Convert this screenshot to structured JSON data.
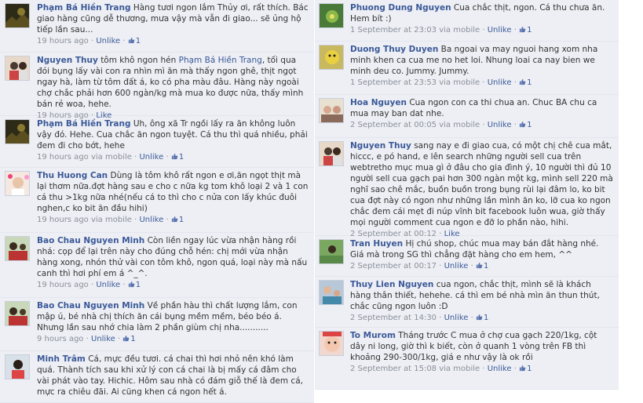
{
  "left_comments": [
    {
      "author": "Phạm Bá Hiền Trang",
      "text": "Hàng tươi ngon lắm Thủy ơi, rất thích. Bác giao hàng cũng dễ thương, mưa vậy mà vẫn đi giao... sẽ ủng hộ tiếp lần sau...",
      "time": "19 hours ago",
      "via": "",
      "action": "Unlike",
      "likes": "1",
      "avatar": "dark-landscape"
    },
    {
      "author": "Nguyen Thuy",
      "mention": "Phạm Bá Hiền Trang",
      "text": "tôm khô ngon hén Phạm Bá Hiền Trang, tối qua đói bụng lấy vài con ra nhìn mì ăn mà thấy ngon ghê, thịt ngọt ngay hà, làm từ tôm đất á, ko có pha màu đâu. Hàng này ngoài chợ chắc phải hơn 600 ngàn/kg mà mua ko được nữa, thấy mình bán rẻ woa, hehe.",
      "time": "19 hours ago",
      "via": "",
      "action": "Like",
      "likes": "",
      "avatar": "couple"
    },
    {
      "author": "Phạm Bá Hiền Trang",
      "text": "Uh, ông xã Tr ngồi lấy ra ăn không luôn vậy đó. Hehe. Cua chắc ăn ngon tuyệt. Cá thu thì quá nhiều, phải đem đi cho bớt, hehe",
      "time": "19 hours ago",
      "via": "via mobile",
      "action": "Unlike",
      "likes": "1",
      "avatar": "dark-landscape"
    },
    {
      "author": "Thu Huong Can",
      "text": "Dùng là tôm khô rất ngon e ơi,ăn ngọt thịt mà lại thơm nữa.đợt hàng sau e cho c nữa kg tom khô loại 2 và 1 con cá thu >1kg nữa nhé(nếu cá to thì cho c nửa con lấy khúc đuôi nghen,c ko bit ăn đầu hihi)",
      "time": "19 hours ago",
      "via": "via mobile",
      "action": "Unlike",
      "likes": "1",
      "avatar": "baby-flowers"
    },
    {
      "author": "Bao Chau Nguyen Minh",
      "text": "Còn liền ngay lúc vừa nhận hàng rồi nhá: cọp để lại trên này cho đúng chỗ hén: chị mới vừa nhận hàng xong, nhón thử vài con tôm khô, ngon quá, loại này mà nấu canh thì hơi phí em á ^_^.",
      "time": "19 hours ago",
      "via": "",
      "action": "Unlike",
      "likes": "1",
      "avatar": "family"
    },
    {
      "author": "Bao Chau Nguyen Minh",
      "text": "Về phần hàu thì chất lượng lắm, con mập ú, bé nhà chị thích ăn cái bụng mềm mềm, béo béo á. Nhưng lần sau nhớ chia làm 2 phần giùm chị nha...........",
      "time": "9 hours ago",
      "via": "",
      "action": "Unlike",
      "likes": "1",
      "avatar": "family"
    },
    {
      "author": "Minh Trâm",
      "text": "Cá, mực đều tươi. cá chai thì hơi nhỏ nên khó làm quá. Thành tích sau khi xử lý con cá chai là bị mấy cá đâm cho vài phát vào tay. Hichic. Hôm sau nhà có đám giỗ thế là đem cá, mực ra chiêu đãi. Ai cũng khen cá ngon hết á.",
      "time": "",
      "via": "",
      "action": "",
      "likes": "",
      "avatar": "woman"
    }
  ],
  "right_comments": [
    {
      "author": "Phuong Dung Nguyen",
      "text": "Cua chắc thịt, ngon. Cá thu chưa ăn. Hem bít :)",
      "time": "1 September at 23:03",
      "via": "via mobile",
      "action": "Unlike",
      "likes": "1",
      "avatar": "flower-green"
    },
    {
      "author": "Duong Thuy Duyen",
      "text": "Ba ngoai va may nguoi hang xom nha minh khen ca cua me no het loi. Nhung loai ca nay bien we minh deu co. Jummy. Jummy.",
      "time": "1 September at 23:53",
      "via": "via mobile",
      "action": "Unlike",
      "likes": "1",
      "avatar": "toy-yellow"
    },
    {
      "author": "Hoa Nguyen",
      "text": "Cua ngon con ca thi chua an. Chuc BA chu ca mua may ban dat nhe.",
      "time": "2 September at 00:05",
      "via": "via mobile",
      "action": "Unlike",
      "likes": "1",
      "avatar": "kids-couch"
    },
    {
      "author": "Nguyen Thuy",
      "text": "sang nay e đi giao cua, có một chị chê cua mắt, hiccc, e pó hand, e lên search những người sell cua trên webtretho mục mua gì ở đâu cho gia đình ý, 10 người thì đủ 10 người sell cua gạch pai hơn 300 ngàn một kg, mình sell 220 mà nghĩ sao chê mắc, buồn buồn trong bụng rùi lại đâm lo, ko bit cua đợt này có ngon như những lần mình ăn ko, lỡ cua ko ngon chắc đem cái mẹt đi núp vĩnh bit facebook luôn wua, giờ thấy mọi người comment cua ngon e đỡ lo phần nào, hihi.",
      "time": "2 September at 00:12",
      "via": "",
      "action": "Like",
      "likes": "",
      "avatar": "couple"
    },
    {
      "author": "Tran Huyen",
      "text": "Hị chú shop, chúc mua may bán đắt hàng nhé. Giá mà trong SG thì chẳng đặt hàng cho em hem, ^^",
      "time": "2 September at 00:17",
      "via": "",
      "action": "Unlike",
      "likes": "1",
      "avatar": "outdoor-green"
    },
    {
      "author": "Thuy Lien Nguyen",
      "text": "cua ngon, chắc thịt, mình sẽ là khách hàng thân thiết, hehehe. cá thì em bé nhà mìn ăn thun thút, chắc cũng ngon luôn :D",
      "time": "2 September at 14:30",
      "via": "",
      "action": "Unlike",
      "likes": "1",
      "avatar": "family-kid"
    },
    {
      "author": "To Murom",
      "text": "Tháng trước C mua ở chợ cua gạch 220/1kg, cột dây ni long, giờ thì k biết, còn ở quanh 1 vòng trên FB thì khoảng 290-300/1kg, giá e như vậy là ok rồi",
      "time": "2 September at 15:08",
      "via": "via mobile",
      "action": "Unlike",
      "likes": "1",
      "avatar": "baby-face"
    }
  ],
  "colors": {
    "link": "#3b5998",
    "panel": "#edeff4",
    "meta": "#8a8f99"
  }
}
